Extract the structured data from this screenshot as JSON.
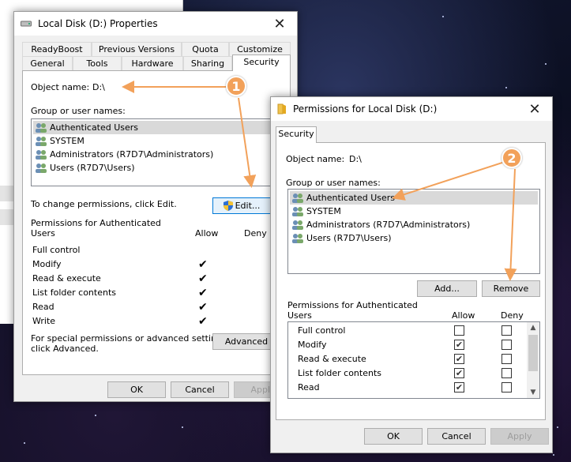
{
  "properties_window": {
    "title": "Local Disk (D:) Properties",
    "tabs_row1": [
      "ReadyBoost",
      "Previous Versions",
      "Quota",
      "Customize"
    ],
    "tabs_row2": [
      "General",
      "Tools",
      "Hardware",
      "Sharing",
      "Security"
    ],
    "active_tab": "Security",
    "object_name_label": "Object name:",
    "object_name_value": "D:\\",
    "group_label": "Group or user names:",
    "users": [
      "Authenticated Users",
      "SYSTEM",
      "Administrators (R7D7\\Administrators)",
      "Users (R7D7\\Users)"
    ],
    "change_text": "To change permissions, click Edit.",
    "edit_button": "Edit...",
    "permissions_label_line1": "Permissions for Authenticated",
    "permissions_label_line2": "Users",
    "allow_header": "Allow",
    "deny_header": "Deny",
    "permissions": [
      {
        "name": "Full control",
        "allow": false
      },
      {
        "name": "Modify",
        "allow": true
      },
      {
        "name": "Read & execute",
        "allow": true
      },
      {
        "name": "List folder contents",
        "allow": true
      },
      {
        "name": "Read",
        "allow": true
      },
      {
        "name": "Write",
        "allow": true
      }
    ],
    "special_text_line1": "For special permissions or advanced settings,",
    "special_text_line2": "click Advanced.",
    "advanced_button": "Advanced",
    "ok_button": "OK",
    "cancel_button": "Cancel",
    "apply_button": "Apply"
  },
  "permissions_window": {
    "title": "Permissions for Local Disk (D:)",
    "tab": "Security",
    "object_name_label": "Object name:",
    "object_name_value": "D:\\",
    "group_label": "Group or user names:",
    "users": [
      "Authenticated Users",
      "SYSTEM",
      "Administrators (R7D7\\Administrators)",
      "Users (R7D7\\Users)"
    ],
    "add_button": "Add...",
    "remove_button": "Remove",
    "permissions_label_line1": "Permissions for Authenticated",
    "permissions_label_line2": "Users",
    "allow_header": "Allow",
    "deny_header": "Deny",
    "permissions": [
      {
        "name": "Full control",
        "allow": false,
        "deny": false
      },
      {
        "name": "Modify",
        "allow": true,
        "deny": false
      },
      {
        "name": "Read & execute",
        "allow": true,
        "deny": false
      },
      {
        "name": "List folder contents",
        "allow": true,
        "deny": false
      },
      {
        "name": "Read",
        "allow": true,
        "deny": false
      }
    ],
    "ok_button": "OK",
    "cancel_button": "Cancel",
    "apply_button": "Apply"
  },
  "annotations": {
    "badge1": "1",
    "badge2": "2",
    "color": "#f2a15a"
  },
  "icons": {
    "drive": "drive-icon",
    "folder": "folder-icon",
    "users": "user-group-icon",
    "shield": "uac-shield-icon",
    "check": "check-icon",
    "close": "close-icon"
  }
}
